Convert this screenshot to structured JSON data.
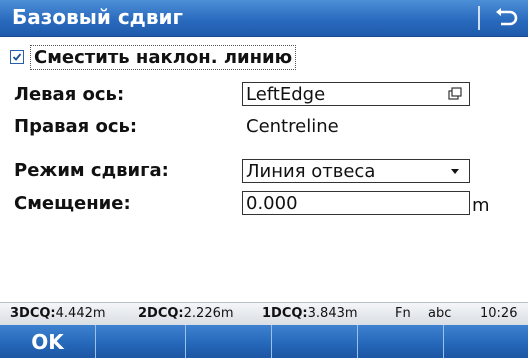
{
  "header": {
    "title": "Базовый сдвиг",
    "back_icon": "back-arrow-icon"
  },
  "form": {
    "checkbox": {
      "label": "Сместить наклон. линию",
      "checked": true
    },
    "left_axis": {
      "label": "Левая ось:",
      "value": "LeftEdge",
      "icon": "picker-icon"
    },
    "right_axis": {
      "label": "Правая ось:",
      "value": "Centreline"
    },
    "offset_mode": {
      "label": "Режим сдвига:",
      "value": "Линия отвеса",
      "icon": "dropdown-arrow-icon"
    },
    "offset": {
      "label": "Смещение:",
      "value": "0.000",
      "unit": "m"
    }
  },
  "status": {
    "q3_label": "3DCQ:",
    "q3_value": "4.442m",
    "q2_label": "2DCQ:",
    "q2_value": "2.226m",
    "q1_label": "1DCQ:",
    "q1_value": "3.843m",
    "fn": "Fn",
    "input_mode": "abc",
    "time": "10:26"
  },
  "softkeys": [
    "OK",
    "",
    "",
    "",
    "",
    ""
  ]
}
